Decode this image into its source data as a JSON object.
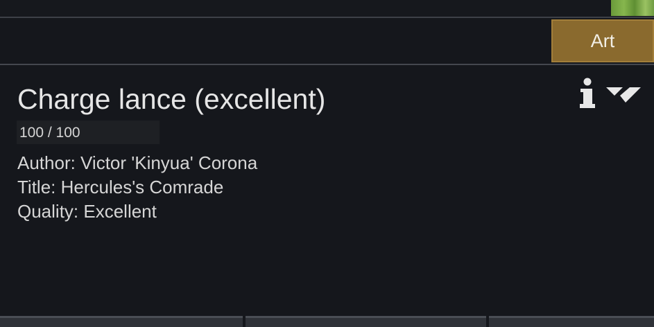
{
  "tabs": {
    "art_label": "Art"
  },
  "item": {
    "title": "Charge lance (excellent)",
    "hit_points": "100 / 100",
    "author_line": "Author: Victor 'Kinyua' Corona",
    "title_line": "Title: Hercules's Comrade",
    "quality_line": "Quality: Excellent"
  },
  "icons": {
    "info": "info-icon",
    "collapse": "collapse-icon"
  },
  "colors": {
    "background": "#15171c",
    "art_tab": "#8a6a2e",
    "text": "#d8d8d8"
  }
}
